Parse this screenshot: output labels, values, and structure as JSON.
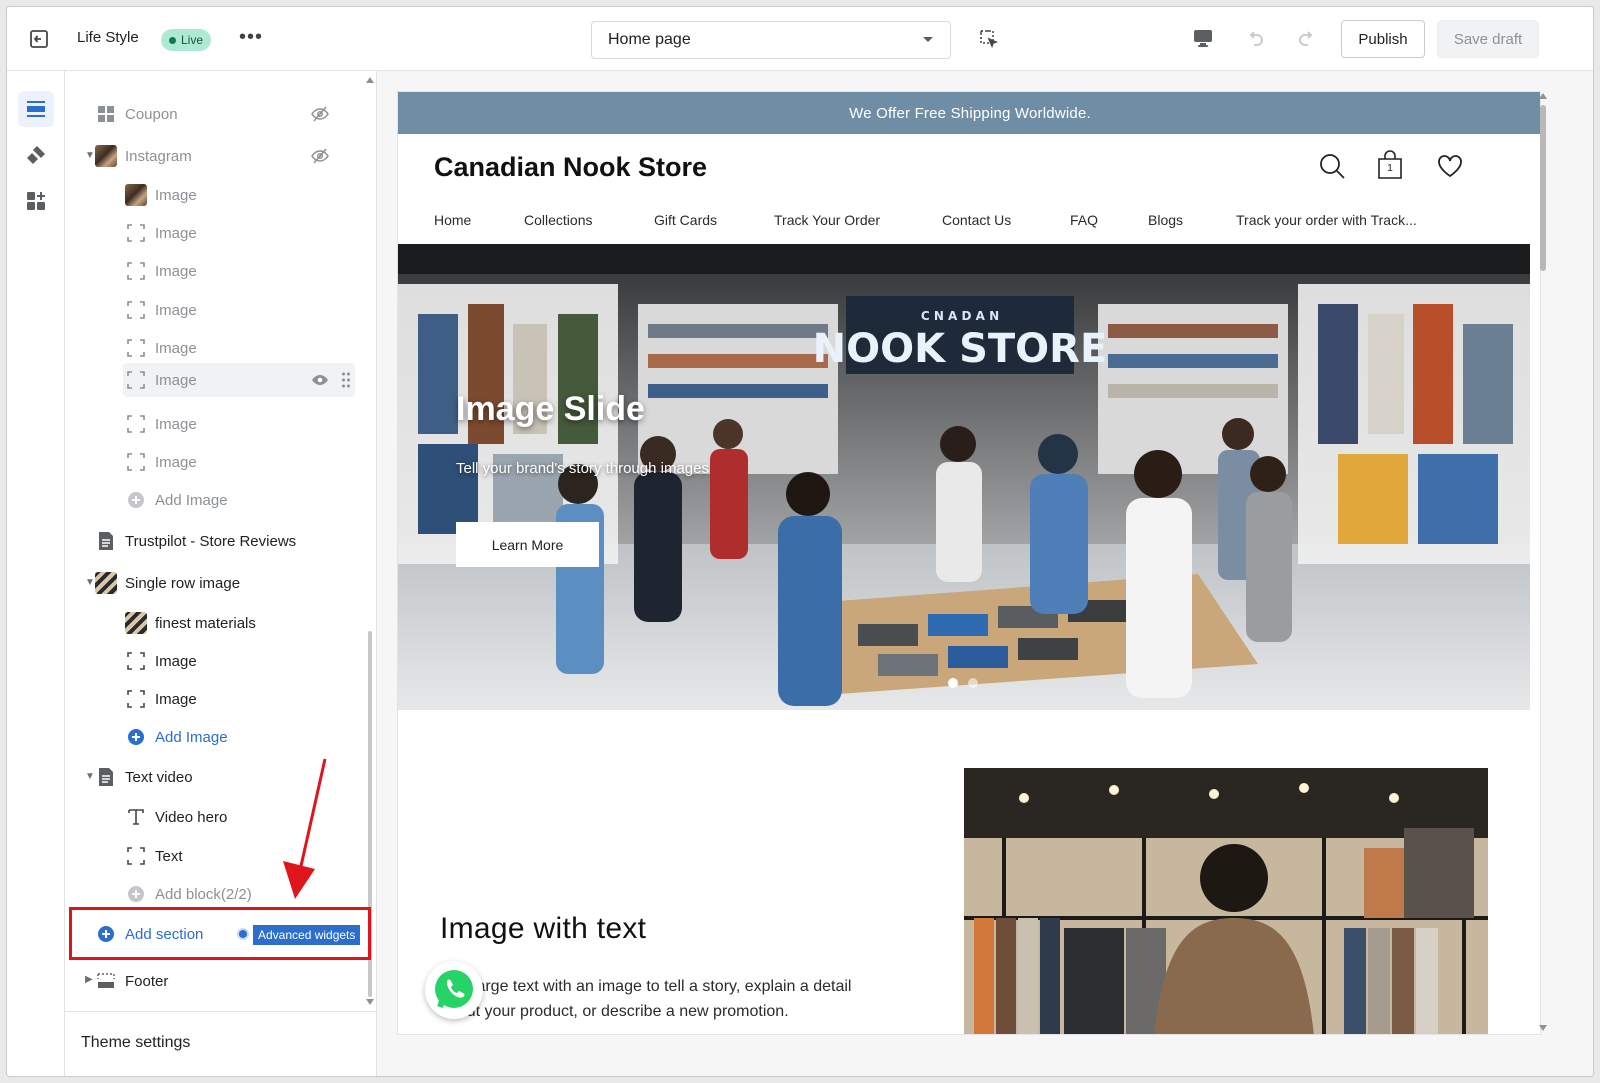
{
  "topbar": {
    "store_name": "Life Style",
    "status": "Live",
    "page_selector": "Home page",
    "publish_label": "Publish",
    "save_draft_label": "Save draft",
    "icons": [
      "exit-icon",
      "more-icon",
      "chevron-down-icon",
      "select-element-icon",
      "desktop-icon",
      "undo-icon",
      "redo-icon"
    ]
  },
  "rail": {
    "items": [
      "sections-icon",
      "theme-style-icon",
      "apps-icon"
    ]
  },
  "tree": {
    "rows": [
      {
        "label": "Coupon"
      },
      {
        "label": "Instagram"
      },
      {
        "label": "Image"
      },
      {
        "label": "Image"
      },
      {
        "label": "Image"
      },
      {
        "label": "Image"
      },
      {
        "label": "Image"
      },
      {
        "label": "Image"
      },
      {
        "label": "Image"
      },
      {
        "label": "Image"
      },
      {
        "label": "Add Image"
      },
      {
        "label": "Trustpilot - Store Reviews"
      },
      {
        "label": "Single row image"
      },
      {
        "label": "finest materials"
      },
      {
        "label": "Image"
      },
      {
        "label": "Image"
      },
      {
        "label": "Add Image"
      },
      {
        "label": "Text video"
      },
      {
        "label": "Video hero"
      },
      {
        "label": "Text"
      },
      {
        "label": "Add block(2/2)"
      },
      {
        "label": "Add section"
      },
      {
        "label": "Footer"
      }
    ],
    "advanced_widgets": "Advanced widgets",
    "theme_settings": "Theme settings"
  },
  "preview": {
    "announcement": "We Offer Free Shipping Worldwide.",
    "store_title": "Canadian Nook Store",
    "cart_count": "1",
    "nav": [
      "Home",
      "Collections",
      "Gift Cards",
      "Track Your Order",
      "Contact Us",
      "FAQ",
      "Blogs",
      "Track your order with Track..."
    ],
    "hero": {
      "sign": "NOOK STORE",
      "sign_small": "C N A D A N",
      "title": "Image Slide",
      "subtitle": "Tell your brand's story through images",
      "button": "Learn More",
      "slide_count": 2,
      "active_slide": 1
    },
    "image_with_text": {
      "title": "Image with text",
      "body": "Pair large text with an image to tell a story, explain a detail about your product, or describe a new promotion."
    }
  },
  "colors": {
    "accent": "#2c6ecb",
    "announcement_bg": "#6f8ea5",
    "live_badge_bg": "#aee9d1",
    "highlight_box": "#e0151c"
  }
}
